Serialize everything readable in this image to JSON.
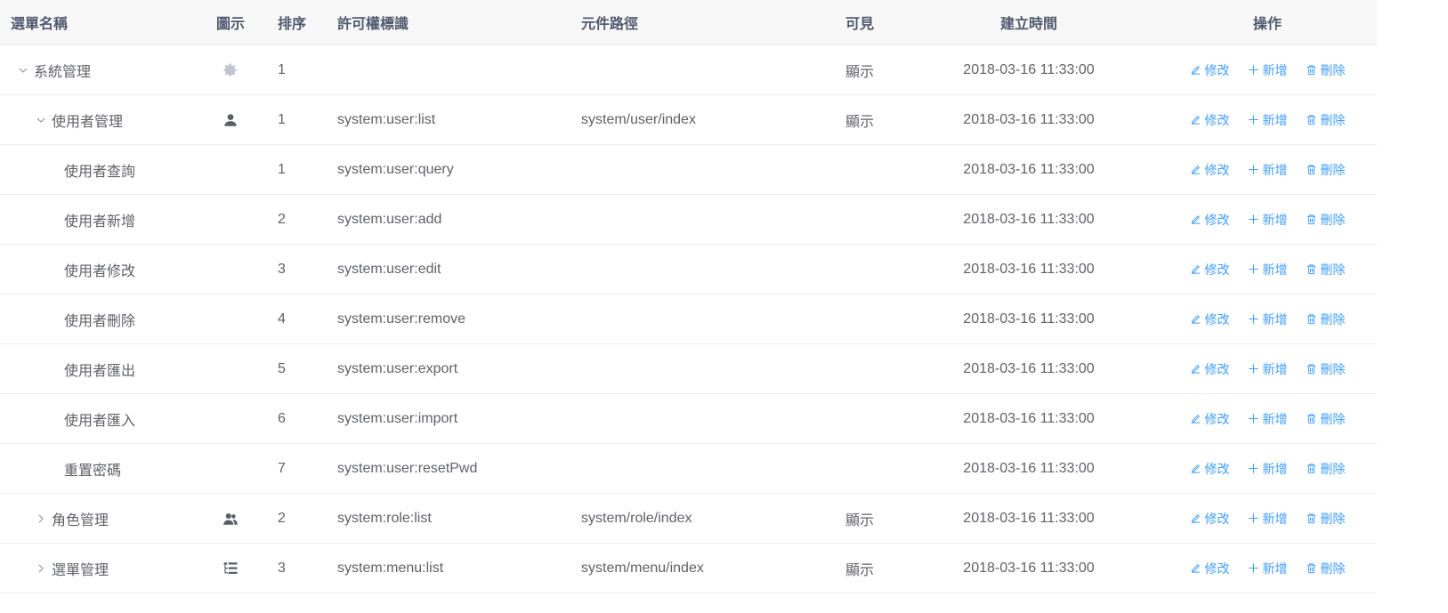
{
  "columns": {
    "name": "選單名稱",
    "icon": "圖示",
    "order": "排序",
    "perm": "許可權標識",
    "path": "元件路徑",
    "visible": "可見",
    "created": "建立時間",
    "ops": "操作"
  },
  "actions": {
    "edit": "修改",
    "add": "新增",
    "delete": "刪除"
  },
  "rows": [
    {
      "name": "系統管理",
      "icon": "gear-icon",
      "order": "1",
      "perm": "",
      "path": "",
      "visible": "顯示",
      "created": "2018-03-16 11:33:00",
      "expand": "expanded"
    },
    {
      "name": "使用者管理",
      "icon": "user-icon",
      "order": "1",
      "perm": "system:user:list",
      "path": "system/user/index",
      "visible": "顯示",
      "created": "2018-03-16 11:33:00",
      "expand": "expanded"
    },
    {
      "name": "使用者查詢",
      "icon": "",
      "order": "1",
      "perm": "system:user:query",
      "path": "",
      "visible": "",
      "created": "2018-03-16 11:33:00",
      "expand": ""
    },
    {
      "name": "使用者新增",
      "icon": "",
      "order": "2",
      "perm": "system:user:add",
      "path": "",
      "visible": "",
      "created": "2018-03-16 11:33:00",
      "expand": ""
    },
    {
      "name": "使用者修改",
      "icon": "",
      "order": "3",
      "perm": "system:user:edit",
      "path": "",
      "visible": "",
      "created": "2018-03-16 11:33:00",
      "expand": ""
    },
    {
      "name": "使用者刪除",
      "icon": "",
      "order": "4",
      "perm": "system:user:remove",
      "path": "",
      "visible": "",
      "created": "2018-03-16 11:33:00",
      "expand": ""
    },
    {
      "name": "使用者匯出",
      "icon": "",
      "order": "5",
      "perm": "system:user:export",
      "path": "",
      "visible": "",
      "created": "2018-03-16 11:33:00",
      "expand": ""
    },
    {
      "name": "使用者匯入",
      "icon": "",
      "order": "6",
      "perm": "system:user:import",
      "path": "",
      "visible": "",
      "created": "2018-03-16 11:33:00",
      "expand": ""
    },
    {
      "name": "重置密碼",
      "icon": "",
      "order": "7",
      "perm": "system:user:resetPwd",
      "path": "",
      "visible": "",
      "created": "2018-03-16 11:33:00",
      "expand": ""
    },
    {
      "name": "角色管理",
      "icon": "peoples-icon",
      "order": "2",
      "perm": "system:role:list",
      "path": "system/role/index",
      "visible": "顯示",
      "created": "2018-03-16 11:33:00",
      "expand": "collapsed"
    },
    {
      "name": "選單管理",
      "icon": "tree-table-icon",
      "order": "3",
      "perm": "system:menu:list",
      "path": "system/menu/index",
      "visible": "顯示",
      "created": "2018-03-16 11:33:00",
      "expand": "collapsed"
    }
  ],
  "colors": {
    "link": "#409eff",
    "text": "#606266",
    "header_bg": "#f8f8f9"
  }
}
